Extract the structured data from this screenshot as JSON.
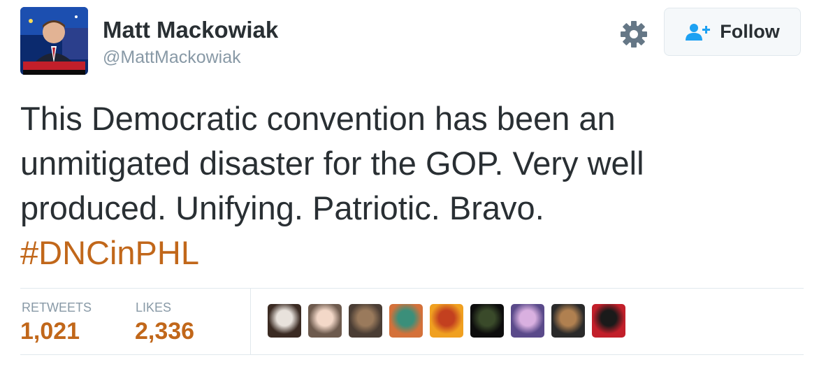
{
  "author": {
    "name": "Matt Mackowiak",
    "handle": "@MattMackowiak",
    "avatar_icon": "news-anchor-portrait"
  },
  "header": {
    "settings_icon": "gear-icon",
    "follow_label": "Follow",
    "follow_icon": "add-user-icon"
  },
  "tweet": {
    "lines": [
      "This Democratic convention has been an",
      "unmitigated disaster for the GOP. Very well",
      "produced. Unifying. Patriotic. Bravo."
    ],
    "hashtag": "#DNCinPHL"
  },
  "stats": {
    "retweets_label": "RETWEETS",
    "retweets_value": "1,021",
    "likes_label": "LIKES",
    "likes_value": "2,336"
  },
  "likers": [
    {
      "colors": [
        "#3a2a22",
        "#e8e2dc"
      ]
    },
    {
      "colors": [
        "#6d5a4d",
        "#f3d8c8"
      ]
    },
    {
      "colors": [
        "#4a3d34",
        "#9a7a5c"
      ]
    },
    {
      "colors": [
        "#d4713a",
        "#3b8f7a"
      ]
    },
    {
      "colors": [
        "#f0a020",
        "#c3401f"
      ]
    },
    {
      "colors": [
        "#0d0d0d",
        "#3a4a2a"
      ]
    },
    {
      "colors": [
        "#5a4a8a",
        "#d9b0e0"
      ]
    },
    {
      "colors": [
        "#2a2a2a",
        "#b08050"
      ]
    },
    {
      "colors": [
        "#c21f2a",
        "#1a1a1a"
      ]
    }
  ],
  "colors": {
    "accent": "#c1671a",
    "muted": "#8899a6",
    "text": "#292f33"
  }
}
